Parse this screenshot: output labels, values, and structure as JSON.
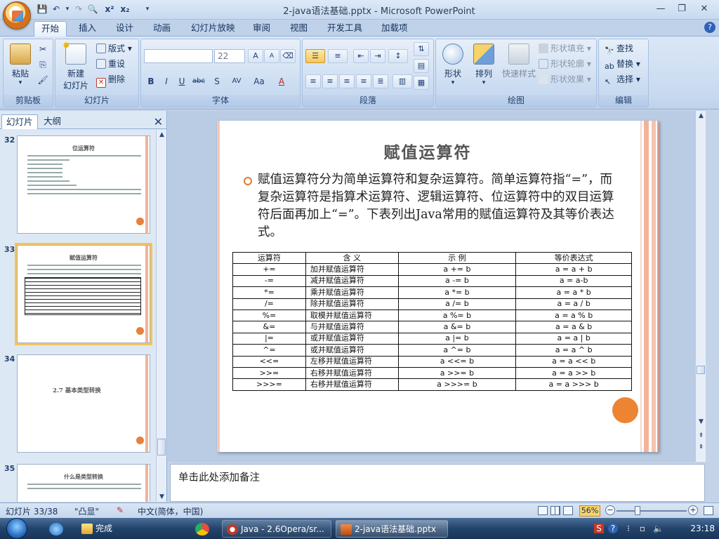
{
  "window": {
    "title": "2-java语法基础.pptx - Microsoft PowerPoint",
    "minimize": "—",
    "restore": "❐",
    "close": "✕"
  },
  "ribbon_tabs": [
    "开始",
    "插入",
    "设计",
    "动画",
    "幻灯片放映",
    "审阅",
    "视图",
    "开发工具",
    "加载项"
  ],
  "help_label": "?",
  "ribbon": {
    "clipboard": {
      "label": "剪贴板",
      "paste": "粘贴"
    },
    "slides": {
      "label": "幻灯片",
      "new_slide": "新建",
      "new_slide2": "幻灯片",
      "layout": "版式",
      "reset": "重设",
      "delete": "删除"
    },
    "font": {
      "label": "字体",
      "font_size": "22",
      "bold": "B",
      "italic": "I",
      "underline": "U",
      "strike": "abc",
      "shadow": "S",
      "spacing": "AV",
      "case": "Aa",
      "grow": "A",
      "shrink": "A",
      "color": "A"
    },
    "paragraph": {
      "label": "段落"
    },
    "drawing": {
      "label": "绘图",
      "shape": "形状",
      "arrange": "排列",
      "quick_styles": "快速样式",
      "fill": "形状填充",
      "outline": "形状轮廓",
      "effects": "形状效果"
    },
    "editing": {
      "label": "编辑",
      "find": "查找",
      "replace": "替换",
      "select": "选择"
    }
  },
  "left_pane": {
    "tabs": [
      "幻灯片",
      "大纲"
    ],
    "close": "✕",
    "thumbnails": [
      {
        "num": "32",
        "title": "位运算符"
      },
      {
        "num": "33",
        "title": "赋值运算符"
      },
      {
        "num": "34",
        "title": "2.7 基本类型转换"
      },
      {
        "num": "35",
        "title": "什么是类型转换"
      }
    ]
  },
  "slide": {
    "title": "赋值运算符",
    "body": "赋值运算符分为简单运算符和复杂运算符。简单运算符指“=”，而复杂运算符是指算术运算符、逻辑运算符、位运算符中的双目运算符后面再加上“=”。下表列出Java常用的赋值运算符及其等价表达式。",
    "table_headers": [
      "运算符",
      "含  义",
      "示  例",
      "等价表达式"
    ],
    "table_rows": [
      [
        "+=",
        "加并赋值运算符",
        "a += b",
        "a = a + b"
      ],
      [
        "-=",
        "减并赋值运算符",
        "a -= b",
        "a = a-b"
      ],
      [
        "*=",
        "乘并赋值运算符",
        "a *= b",
        "a = a * b"
      ],
      [
        "/=",
        "除并赋值运算符",
        "a /= b",
        "a = a / b"
      ],
      [
        "%=",
        "取模并赋值运算符",
        "a %= b",
        "a = a % b"
      ],
      [
        "&=",
        "与并赋值运算符",
        "a &= b",
        "a = a & b"
      ],
      [
        "|=",
        "或并赋值运算符",
        "a |= b",
        "a = a | b"
      ],
      [
        "^=",
        "或并赋值运算符",
        "a ^= b",
        "a = a ^ b"
      ],
      [
        "<<=",
        "左移并赋值运算符",
        "a <<= b",
        "a = a << b"
      ],
      [
        ">>=",
        "右移并赋值运算符",
        "a >>= b",
        "a = a >> b"
      ],
      [
        ">>>=",
        "右移并赋值运算符",
        "a >>>= b",
        "a = a >>> b"
      ]
    ]
  },
  "notes": {
    "placeholder": "单击此处添加备注"
  },
  "status": {
    "slide_count": "幻灯片 33/38",
    "theme": "\"凸显\"",
    "language": "中文(简体，中国)",
    "zoom": "56%"
  },
  "taskbar": {
    "items": [
      {
        "label": "完成"
      },
      {
        "label": "Java - 2.6Opera/sr..."
      },
      {
        "label": "2-java语法基础.pptx"
      }
    ],
    "clock": "23:18"
  },
  "colors": {
    "ribbon_bg": "#c8daf0",
    "accent_orange": "#ec8434",
    "slide_stripe": "#f2b39a",
    "taskbar": "#22436b"
  }
}
